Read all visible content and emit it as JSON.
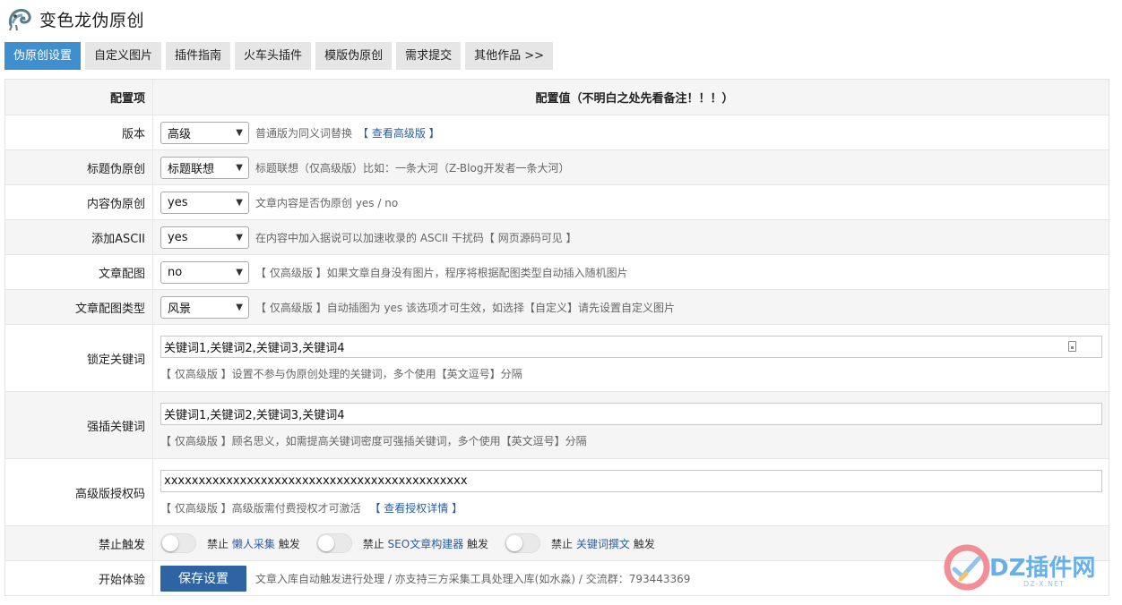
{
  "app": {
    "title": "变色龙伪原创"
  },
  "tabs": [
    {
      "label": "伪原创设置"
    },
    {
      "label": "自定义图片"
    },
    {
      "label": "插件指南"
    },
    {
      "label": "火车头插件"
    },
    {
      "label": "模版伪原创"
    },
    {
      "label": "需求提交"
    },
    {
      "label": "其他作品 >>"
    }
  ],
  "table": {
    "header": {
      "key": "配置项",
      "value": "配置值（不明白之处先看备注！！！）"
    },
    "version": {
      "label": "版本",
      "select": "高级",
      "desc": "普通版为同义词替换",
      "link": "【 查看高级版 】"
    },
    "title_rewrite": {
      "label": "标题伪原创",
      "select": "标题联想",
      "desc": "标题联想（仅高级版）比如：一条大河（Z-Blog开发者一条大河）"
    },
    "content_rewrite": {
      "label": "内容伪原创",
      "select": "yes",
      "desc": "文章内容是否伪原创 yes / no"
    },
    "ascii": {
      "label": "添加ASCII",
      "select": "yes",
      "desc": "在内容中加入据说可以加速收录的 ASCII 干扰码【 网页源码可见 】"
    },
    "image": {
      "label": "文章配图",
      "select": "no",
      "desc": "【 仅高级版 】如果文章自身没有图片，程序将根据配图类型自动插入随机图片"
    },
    "image_type": {
      "label": "文章配图类型",
      "select": "风景",
      "desc": "【 仅高级版 】自动插图为 yes 该选项才可生效，如选择【自定义】请先设置自定义图片"
    },
    "lock_keywords": {
      "label": "锁定关键词",
      "value": "关键词1,关键词2,关键词3,关键词4",
      "hint": "【 仅高级版 】设置不参与伪原创处理的关键词，多个使用【英文逗号】分隔"
    },
    "insert_keywords": {
      "label": "强插关键词",
      "value": "关键词1,关键词2,关键词3,关键词4",
      "hint": "【 仅高级版 】顾名思义，如需提高关键词密度可强插关键词，多个使用【英文逗号】分隔"
    },
    "license": {
      "label": "高级版授权码",
      "value": "xxxxxxxxxxxxxxxxxxxxxxxxxxxxxxxxxxxxxxxxxxxx",
      "hint": "【 仅高级版 】高级版需付费授权才可激活",
      "link": "【 查看授权详情 】"
    },
    "disable": {
      "label": "禁止触发",
      "items": [
        {
          "prefix": "禁止",
          "name": "懒人采集",
          "suffix": "触发",
          "on": false
        },
        {
          "prefix": "禁止",
          "name": "SEO文章构建器",
          "suffix": "触发",
          "on": false
        },
        {
          "prefix": "禁止",
          "name": "关键词撰文",
          "suffix": "触发",
          "on": false
        }
      ]
    },
    "start": {
      "label": "开始体验",
      "button": "保存设置",
      "desc": "文章入库自动触发进行处理 / 亦支持三方采集工具处理入库(如水淼) / 交流群：793443369"
    }
  },
  "watermark": {
    "brand": "DZ插件网",
    "url": "DZ-X.NET"
  },
  "colors": {
    "accent": "#3f8fcf",
    "button": "#2f64a3",
    "link": "#2a5d9f"
  }
}
